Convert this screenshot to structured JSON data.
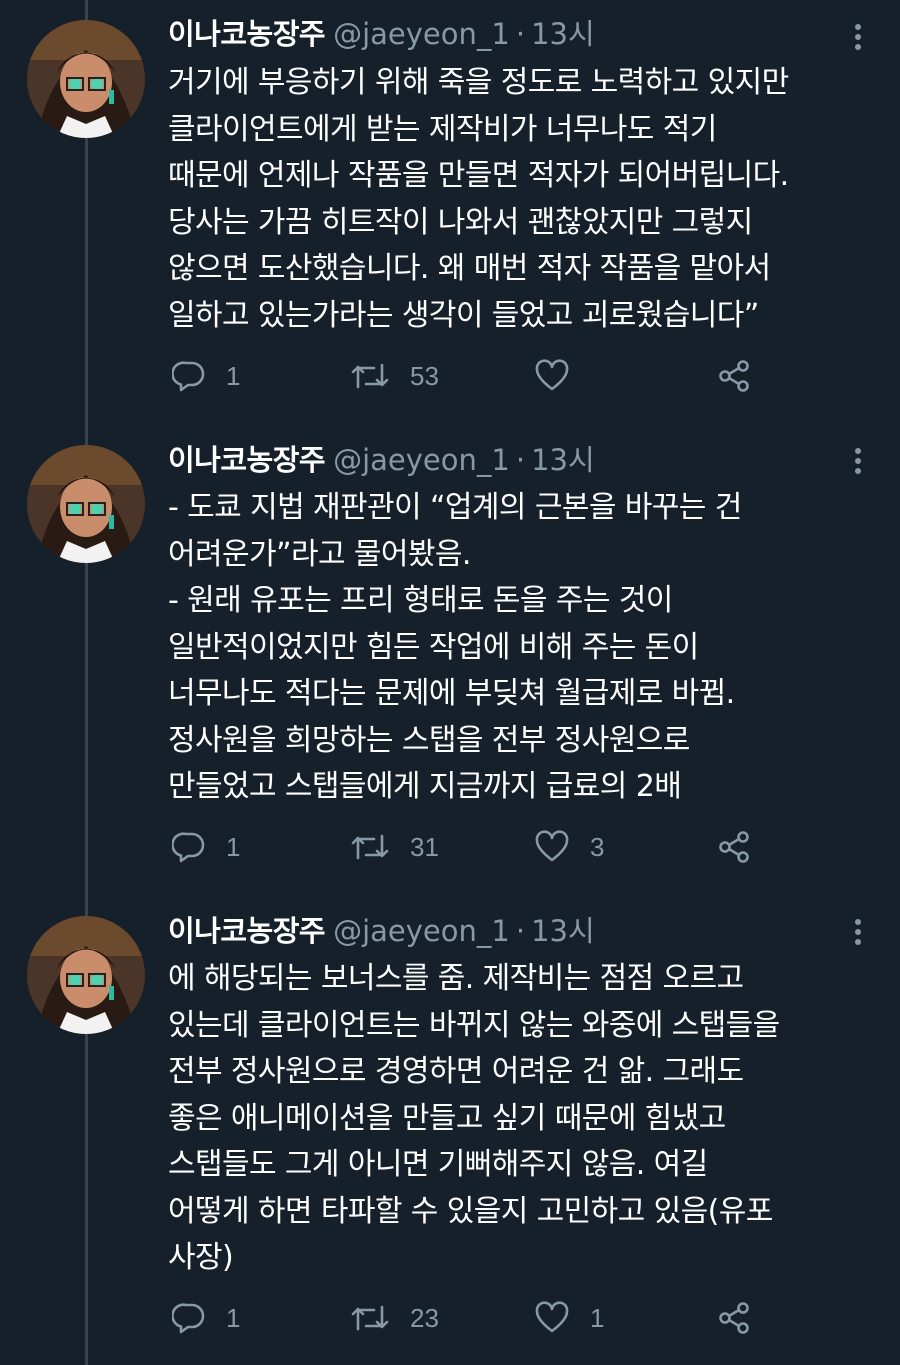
{
  "tweets": [
    {
      "name": "이나코농장주",
      "handle": "@jaeyeon_1",
      "separator": "·",
      "time": "13시",
      "lines": [
        "거기에 부응하기 위해 죽을 정도로 노력하고 있지만",
        "클라이언트에게 받는 제작비가 너무나도 적기",
        "때문에 언제나 작품을 만들면 적자가 되어버립니다.",
        "당사는 가끔 히트작이 나와서 괜찮았지만 그렇지",
        "않으면 도산했습니다. 왜 매번 적자 작품을 맡아서",
        "일하고 있는가라는 생각이 들었고 괴로웠습니다”"
      ],
      "replies": "1",
      "retweets": "53",
      "likes": ""
    },
    {
      "name": "이나코농장주",
      "handle": "@jaeyeon_1",
      "separator": "·",
      "time": "13시",
      "lines": [
        "- 도쿄 지법 재판관이 “업계의 근본을 바꾸는 건",
        "어려운가”라고 물어봤음.",
        "- 원래 유포는 프리 형태로 돈을 주는 것이",
        "일반적이었지만 힘든 작업에 비해 주는 돈이",
        "너무나도 적다는 문제에 부딪쳐 월급제로 바뀜.",
        "정사원을 희망하는 스탭을 전부 정사원으로",
        "만들었고 스탭들에게 지금까지 급료의 2배"
      ],
      "replies": "1",
      "retweets": "31",
      "likes": "3"
    },
    {
      "name": "이나코농장주",
      "handle": "@jaeyeon_1",
      "separator": "·",
      "time": "13시",
      "lines": [
        "에 해당되는 보너스를 줌. 제작비는 점점 오르고",
        "있는데 클라이언트는 바뀌지 않는 와중에 스탭들을",
        "전부 정사원으로 경영하면 어려운 건 앎. 그래도",
        "좋은 애니메이션을 만들고 싶기 때문에 힘냈고",
        "스탭들도 그게 아니면 기뻐해주지 않음. 여길",
        "어떻게 하면 타파할 수 있을지 고민하고 있음(유포",
        "사장)"
      ],
      "replies": "1",
      "retweets": "23",
      "likes": "1"
    }
  ],
  "icons": {
    "reply": "reply-icon",
    "retweet": "retweet-icon",
    "like": "heart-icon",
    "share": "share-icon",
    "more": "more-vertical-icon",
    "avatar": "avatar"
  },
  "colors": {
    "background": "#15202b",
    "primary_text": "#ffffff",
    "secondary_text": "#8899a6",
    "thread_line": "#38444d"
  }
}
